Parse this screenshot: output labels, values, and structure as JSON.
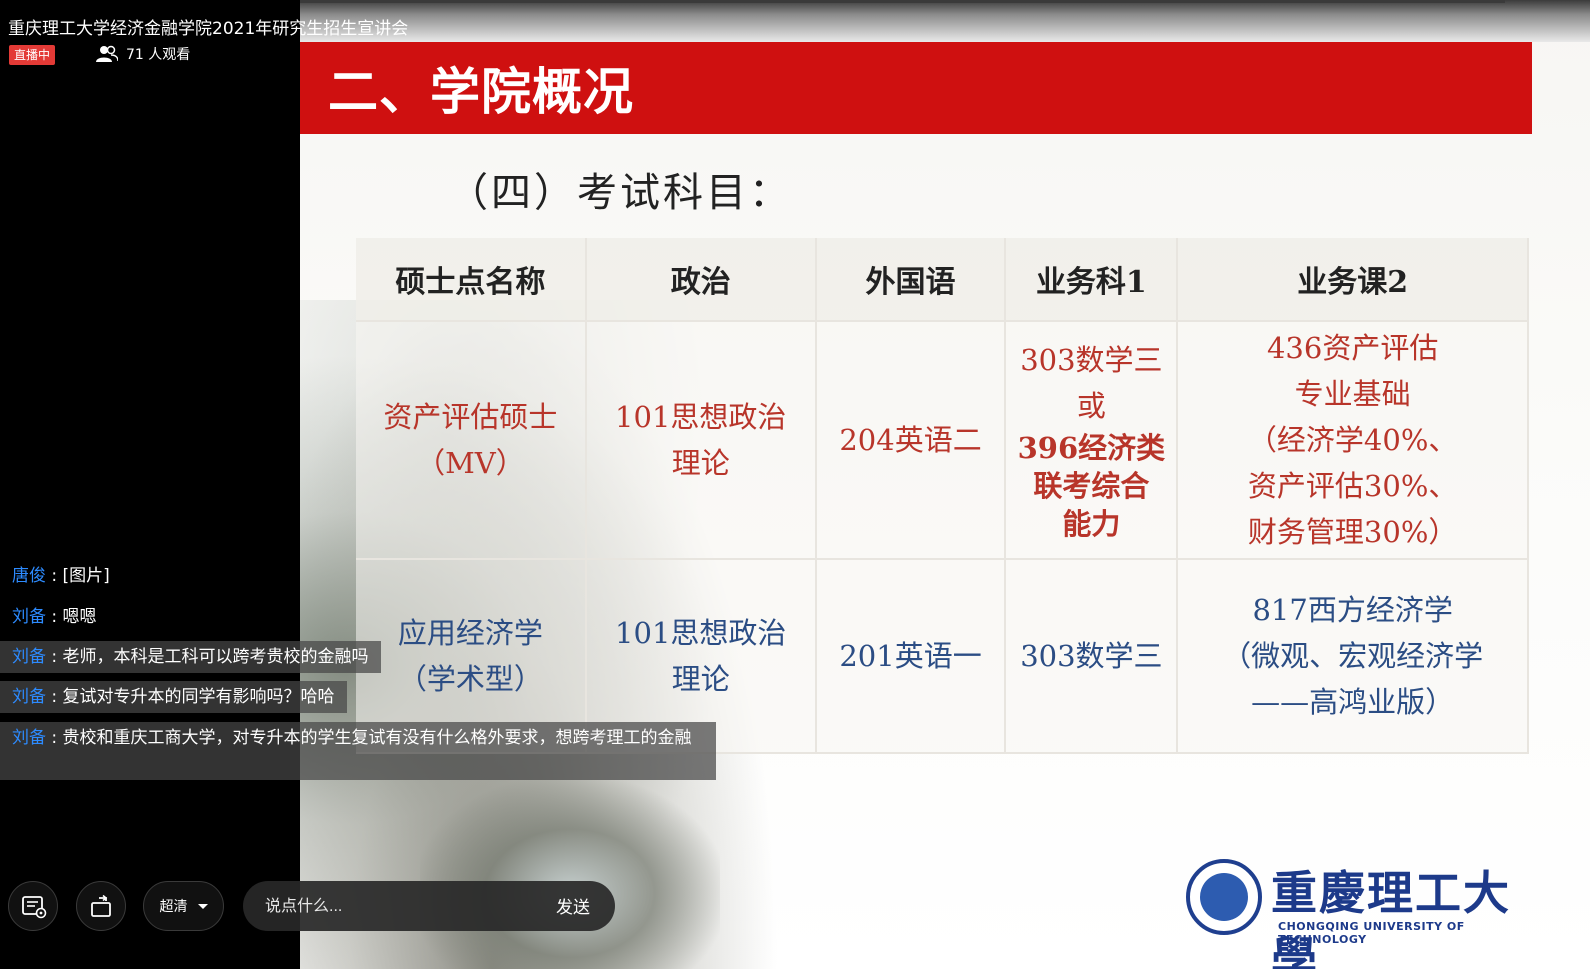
{
  "stream": {
    "title": "重庆理工大学经济金融学院2021年研究生招生宣讲会",
    "live_badge": "直播中",
    "viewers": "71 人观看"
  },
  "slide": {
    "heading": "二、学院概况",
    "subtitle": "（四）考试科目：",
    "table": {
      "headers": [
        "硕士点名称",
        "政治",
        "外国语",
        "业务科1",
        "业务课2"
      ],
      "rows": [
        {
          "name": [
            "资产评估硕士",
            "（MV）"
          ],
          "politics": [
            "101思想政治",
            "理论"
          ],
          "foreign": [
            "204英语二"
          ],
          "course1": [
            "303数学三",
            "或",
            "396经济类",
            "联考综合",
            "能力"
          ],
          "course2": [
            "436资产评估",
            "专业基础",
            "（经济学40%、",
            "资产评估30%、",
            "财务管理30%）"
          ]
        },
        {
          "name": [
            "应用经济学",
            "（学术型）"
          ],
          "politics": [
            "101思想政治",
            "理论"
          ],
          "foreign": [
            "201英语一"
          ],
          "course1": [
            "303数学三"
          ],
          "course2": [
            "817西方经济学",
            "（微观、宏观经济学",
            "——高鸿业版）"
          ]
        }
      ]
    },
    "university": {
      "name": "重慶理工大學",
      "english": "CHONGQING UNIVERSITY OF TECHNOLOGY"
    }
  },
  "chat": [
    {
      "user": "唐俊",
      "text": "[图片]"
    },
    {
      "user": "刘备",
      "text": "嗯嗯"
    },
    {
      "user": "刘备",
      "text": "老师，本科是工科可以跨考贵校的金融吗"
    },
    {
      "user": "刘备",
      "text": "复试对专升本的同学有影响吗？哈哈"
    },
    {
      "user": "刘备",
      "text": "贵校和重庆工商大学，对专升本的学生复试有没有什么格外要求，想跨考理工的金融"
    }
  ],
  "controls": {
    "quality_label": "超清",
    "input_placeholder": "说点什么...",
    "send_label": "发送"
  },
  "colors": {
    "slide_red": "#cf1010",
    "live_badge": "#e33a36",
    "chat_user": "#2d8bff",
    "row1_text": "#b8352a",
    "row2_text": "#2b4d84"
  }
}
